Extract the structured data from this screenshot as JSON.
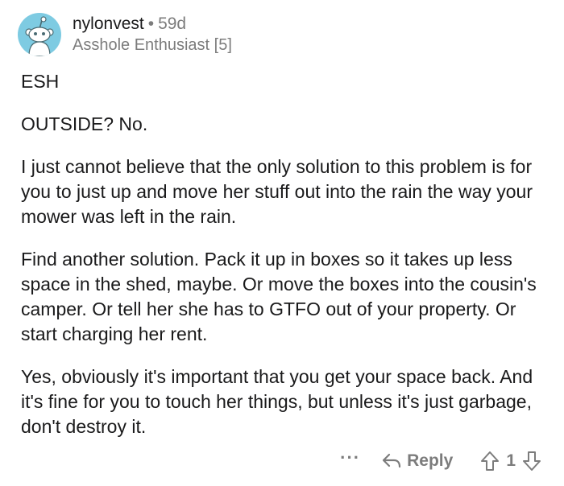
{
  "comment": {
    "username": "nylonvest",
    "separator": "•",
    "age": "59d",
    "flair": "Asshole Enthusiast [5]",
    "paragraphs": [
      "ESH",
      "OUTSIDE? No.",
      "I just cannot believe that the only solution to this problem is for you to just up and move her stuff out into the rain the way your mower was left in the rain.",
      "Find another solution.  Pack it up in boxes so it takes up less space in the shed, maybe.  Or move the boxes into the cousin's camper.  Or tell her she has to GTFO out of your property.  Or start charging her rent.",
      "Yes, obviously it's important that you get your space back.  And it's fine for you to touch her things, but unless it's just garbage, don't destroy it."
    ]
  },
  "actions": {
    "more_label": "···",
    "reply_label": "Reply",
    "vote_count": "1"
  },
  "icons": {
    "avatar": "reddit-snoo-avatar-icon",
    "reply": "reply-arrow-icon",
    "upvote": "upvote-arrow-icon",
    "downvote": "downvote-arrow-icon"
  },
  "colors": {
    "avatar_bg": "#7ecbe2",
    "text": "#1a1a1b",
    "muted": "#7c7c7c"
  }
}
